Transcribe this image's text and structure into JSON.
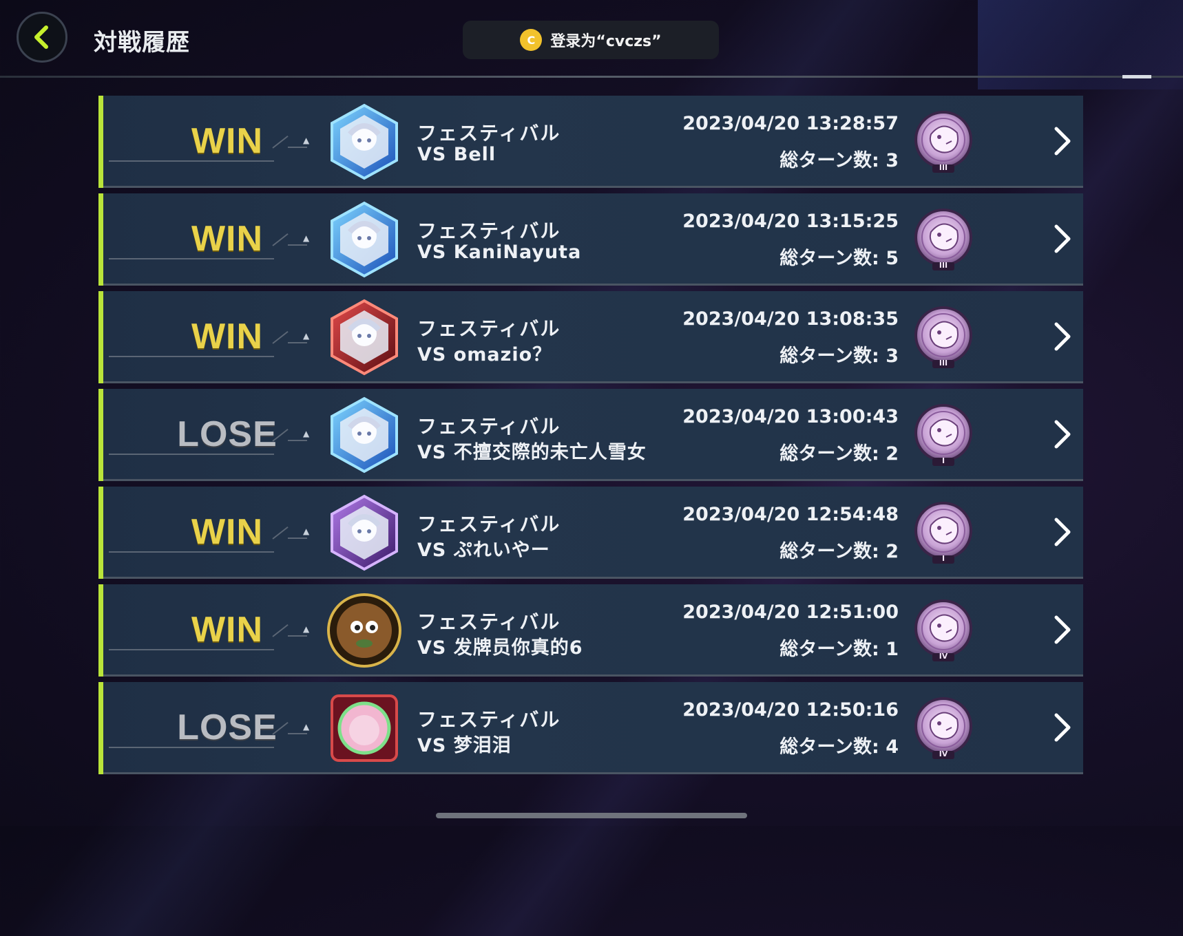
{
  "header": {
    "title": "対戦履歴",
    "login_badge_letter": "C",
    "login_text": "登录为“cvczs”"
  },
  "colors": {
    "win": "#e9d24a",
    "lose": "#b9bcc2",
    "accent_bar": "#b9e43a",
    "row_bg": "#22344a"
  },
  "matches": [
    {
      "result": "WIN",
      "type": "win",
      "mode": "フェスティバル",
      "opponent": "VS Bell",
      "datetime": "2023/04/20 13:28:57",
      "turns": "総ターン数: 3",
      "avatar": "blue-hex-girl-icon",
      "rank_numeral": "III"
    },
    {
      "result": "WIN",
      "type": "win",
      "mode": "フェスティバル",
      "opponent": "VS KaniNayuta",
      "datetime": "2023/04/20 13:15:25",
      "turns": "総ターン数: 5",
      "avatar": "blue-hex-girl-icon",
      "rank_numeral": "III"
    },
    {
      "result": "WIN",
      "type": "win",
      "mode": "フェスティバル",
      "opponent": "VS omazio？",
      "datetime": "2023/04/20 13:08:35",
      "turns": "総ターン数: 3",
      "avatar": "red-hex-icon",
      "rank_numeral": "III"
    },
    {
      "result": "LOSE",
      "type": "lose",
      "mode": "フェスティバル",
      "opponent": "VS 不擅交際的未亡人雪女",
      "datetime": "2023/04/20 13:00:43",
      "turns": "総ターン数: 2",
      "avatar": "blue-hex-girl-icon",
      "rank_numeral": "I"
    },
    {
      "result": "WIN",
      "type": "win",
      "mode": "フェスティバル",
      "opponent": "VS ぷれいやー",
      "datetime": "2023/04/20 12:54:48",
      "turns": "総ターン数: 2",
      "avatar": "purple-hex-girl-icon",
      "rank_numeral": "I"
    },
    {
      "result": "WIN",
      "type": "win",
      "mode": "フェスティバル",
      "opponent": "VS 发牌员你真的6",
      "datetime": "2023/04/20 12:51:00",
      "turns": "総ターン数: 1",
      "avatar": "kuriboh-medallion-icon",
      "rank_numeral": "IV"
    },
    {
      "result": "LOSE",
      "type": "lose",
      "mode": "フェスティバル",
      "opponent": "VS 梦泪泪",
      "datetime": "2023/04/20 12:50:16",
      "turns": "総ターン数: 4",
      "avatar": "pink-frame-icon",
      "rank_numeral": "IV"
    }
  ]
}
